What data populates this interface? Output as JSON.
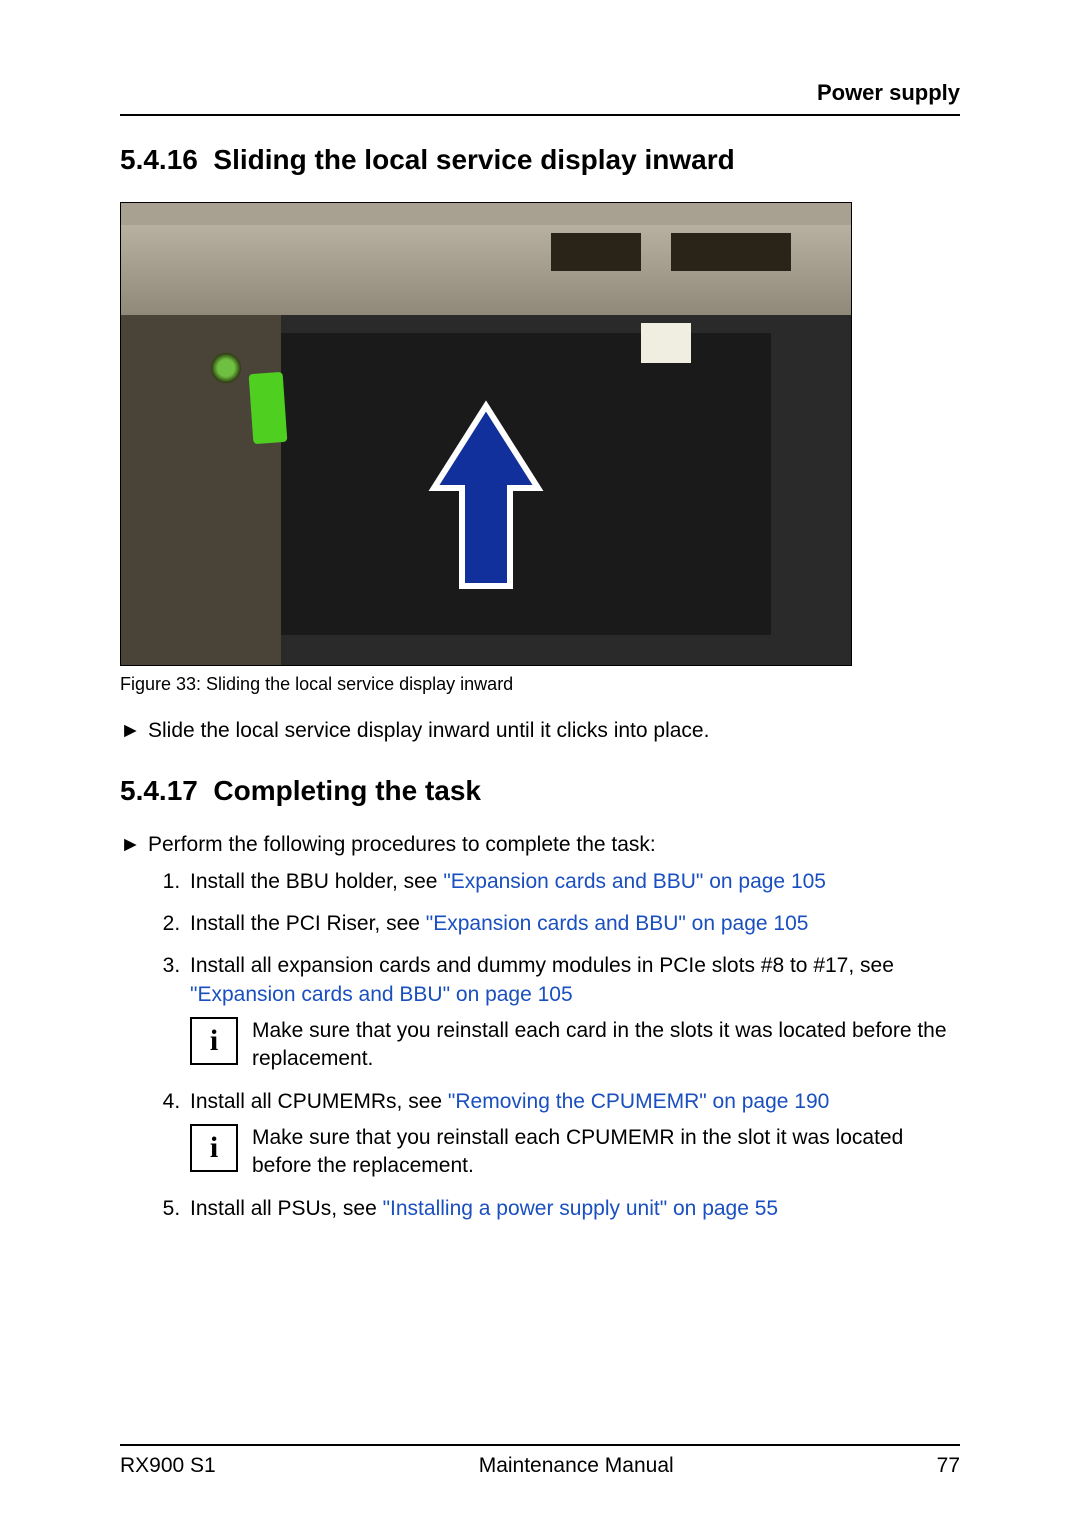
{
  "header": {
    "running_title": "Power supply"
  },
  "section1": {
    "number": "5.4.16",
    "title": "Sliding the local service display inward",
    "figure_caption": "Figure 33: Sliding the local service display inward",
    "step_text": "Slide the local service display inward until it clicks into place."
  },
  "section2": {
    "number": "5.4.17",
    "title": "Completing the task",
    "intro": "Perform the following procedures to complete the task:",
    "items": [
      {
        "text_a": "Install the BBU holder, see ",
        "link": "\"Expansion cards and BBU\" on page 105",
        "text_b": ""
      },
      {
        "text_a": "Install the PCI Riser, see ",
        "link": "\"Expansion cards and BBU\" on page 105",
        "text_b": ""
      },
      {
        "text_a": "Install all expansion cards and dummy modules in PCIe slots #8 to #17, see ",
        "link": "\"Expansion cards and BBU\" on page 105",
        "text_b": "",
        "info": "Make sure that you reinstall each card in the slots it was located before the replacement."
      },
      {
        "text_a": "Install all CPUMEMRs, see ",
        "link": "\"Removing the CPUMEMR\" on page 190",
        "text_b": "",
        "info": "Make sure that you reinstall each CPUMEMR in the slot it was located before the replacement."
      },
      {
        "text_a": "Install all PSUs, see ",
        "link": "\"Installing a power supply unit\" on page 55",
        "text_b": ""
      }
    ]
  },
  "footer": {
    "left": "RX900 S1",
    "center": "Maintenance Manual",
    "right": "77"
  },
  "glyphs": {
    "step": "►",
    "info": "i"
  }
}
